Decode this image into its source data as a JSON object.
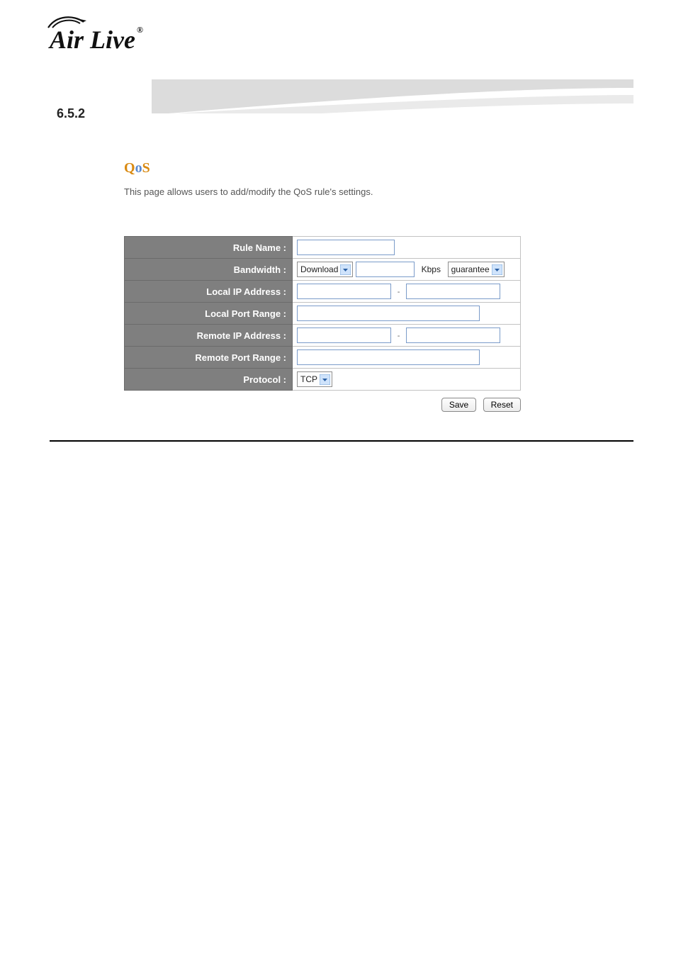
{
  "brand": "Air Live",
  "brand_reg": "®",
  "section_number": "6.5.2",
  "page_title": "QoS",
  "page_title_parts": {
    "q": "Q",
    "o": "o",
    "s": "S"
  },
  "page_desc": "This page allows users to add/modify the QoS rule's settings.",
  "form": {
    "labels": {
      "rule_name": "Rule Name :",
      "bandwidth": "Bandwidth :",
      "local_ip": "Local IP Address :",
      "local_port": "Local Port Range :",
      "remote_ip": "Remote IP Address :",
      "remote_port": "Remote Port Range :",
      "protocol": "Protocol :"
    },
    "values": {
      "rule_name": "",
      "bandwidth_direction": "Download",
      "bandwidth_value": "",
      "bandwidth_unit": "Kbps",
      "bandwidth_mode": "guarantee",
      "local_ip_from": "",
      "local_ip_to": "",
      "local_port_range": "",
      "remote_ip_from": "",
      "remote_ip_to": "",
      "remote_port_range": "",
      "protocol": "TCP",
      "range_sep": "-"
    }
  },
  "buttons": {
    "save": "Save",
    "reset": "Reset"
  }
}
